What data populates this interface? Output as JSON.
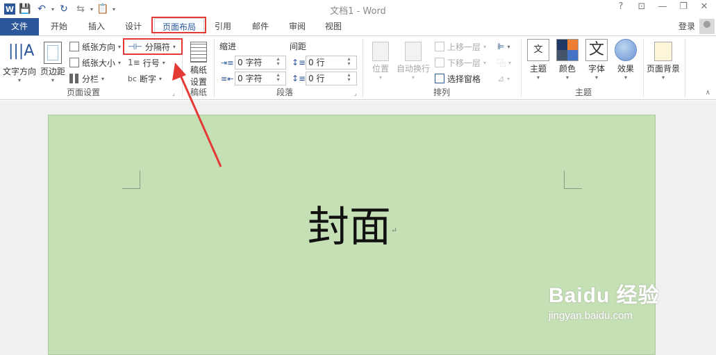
{
  "window": {
    "title": "文档1 - Word",
    "help": "?",
    "minimize": "—",
    "restore": "❐",
    "close": "✕"
  },
  "tabs": [
    "文件",
    "开始",
    "插入",
    "设计",
    "页面布局",
    "引用",
    "邮件",
    "审阅",
    "视图"
  ],
  "active_tab": "页面布局",
  "account": {
    "login": "登录"
  },
  "ribbon": {
    "page_setup": {
      "label": "页面设置",
      "text_direction": "文字方向",
      "margins": "页边距",
      "orientation": "纸张方向",
      "size": "纸张大小",
      "columns": "分栏",
      "breaks": "分隔符",
      "line_numbers": "行号",
      "hyphenation": "断字"
    },
    "manuscript": {
      "label": "稿纸",
      "settings_line1": "稿纸",
      "settings_line2": "设置"
    },
    "paragraph": {
      "label": "段落",
      "indent": "缩进",
      "spacing": "间距",
      "indent_left": "0 字符",
      "indent_right": "0 字符",
      "spacing_before": "0 行",
      "spacing_after": "0 行"
    },
    "arrange": {
      "label": "排列",
      "position": "位置",
      "wrap_text": "自动换行",
      "bring_forward": "上移一层",
      "send_backward": "下移一层",
      "selection_pane": "选择窗格"
    },
    "themes": {
      "label": "主题",
      "themes": "主题",
      "colors": "颜色",
      "fonts": "字体",
      "effects": "效果",
      "font_glyph": "文"
    },
    "page_background": {
      "label": "页面背景"
    }
  },
  "document": {
    "cover_text": "封面",
    "para_mark": "↵",
    "background_color": "#c5e0b4"
  },
  "watermark": {
    "brand": "Bai",
    "brand_suffix": "du 经验",
    "url": "jingyan.baidu.com"
  },
  "colors": {
    "accent": "#2b579a",
    "highlight_red": "#e53935"
  }
}
